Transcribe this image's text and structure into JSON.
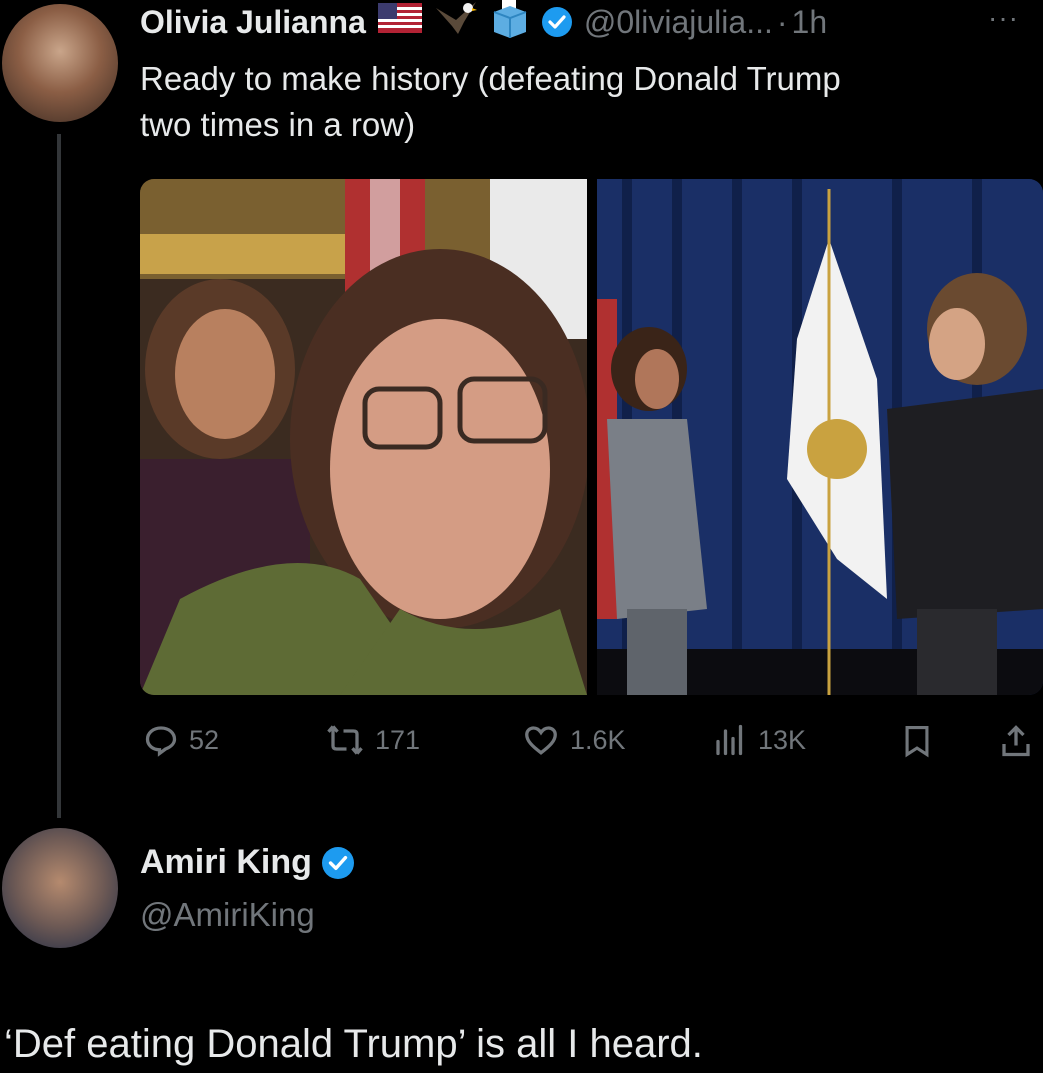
{
  "tweet": {
    "author_name": "Olivia Julianna",
    "handle": "@0liviajulia...",
    "separator": "·",
    "time": "1h",
    "more": "···",
    "text_line1": "Ready to make history (defeating Donald Trump",
    "text_line2": "two times in a row)",
    "images": [
      "selfie-photo",
      "meeting-photo"
    ],
    "stats": {
      "replies": "52",
      "retweets": "171",
      "likes": "1.6K",
      "views": "13K"
    }
  },
  "reply": {
    "author_name": "Amiri King",
    "handle": "@AmiriKing",
    "text": "‘Def eating Donald Trump’ is all I heard."
  },
  "colors": {
    "background": "#000000",
    "text": "#e7e9ea",
    "muted": "#71767b",
    "verified": "#1d9bf0",
    "thread_line": "#333639"
  },
  "icons": [
    "reply-icon",
    "retweet-icon",
    "like-icon",
    "views-icon",
    "bookmark-icon",
    "share-icon",
    "verified-badge-icon",
    "us-flag-icon",
    "eagle-icon",
    "ballot-box-icon"
  ]
}
